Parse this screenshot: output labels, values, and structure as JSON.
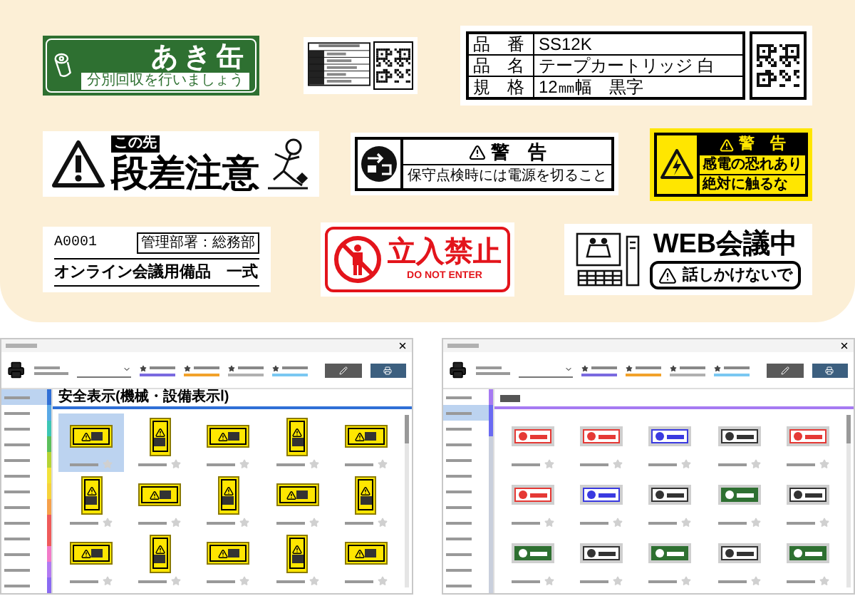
{
  "showcase": {
    "label_rows": [
      {
        "labels": [
          {
            "kind": "recycle",
            "title": "あき缶",
            "subtitle": "分別回収を行いましょう"
          },
          {
            "kind": "asset"
          },
          {
            "kind": "product",
            "rows": [
              {
                "key": "品　番",
                "value": "SS12K"
              },
              {
                "key": "品　名",
                "value": "テープカートリッジ 白"
              },
              {
                "key": "規　格",
                "value": "12㎜幅　黒字"
              }
            ]
          }
        ]
      },
      {
        "labels": [
          {
            "kind": "step-caution",
            "badge": "この先",
            "title": "段差注意"
          },
          {
            "kind": "power-warning",
            "title": "警　告",
            "text": "保守点検時には電源を切ること"
          },
          {
            "kind": "shock-warning",
            "title": "警　告",
            "lines": [
              "感電の恐れあり",
              "絶対に触るな"
            ]
          }
        ]
      },
      {
        "labels": [
          {
            "kind": "equipment",
            "code": "A0001",
            "department": "管理部署：総務部",
            "text": "オンライン会議用備品　一式"
          },
          {
            "kind": "no-entry",
            "title": "立入禁止",
            "subtitle": "DO NOT ENTER"
          },
          {
            "kind": "meeting",
            "title": "WEB会議中",
            "text": "話しかけないで"
          }
        ]
      }
    ]
  },
  "windows": [
    {
      "heading": "安全表示(機械・設備表示Ⅰ)",
      "sidebar": [
        {
          "color": "#2f6fd6",
          "selected": true
        },
        {
          "color": "#5aa9e6",
          "selected": false
        },
        {
          "color": "#3cc6b5",
          "selected": false
        },
        {
          "color": "#5bbf5b",
          "selected": false
        },
        {
          "color": "#b5d334",
          "selected": false
        },
        {
          "color": "#f2e23a",
          "selected": false
        },
        {
          "color": "#f7d23a",
          "selected": false
        },
        {
          "color": "#f6a04a",
          "selected": false
        },
        {
          "color": "#ef5a5a",
          "selected": false
        },
        {
          "color": "#ef5a5a",
          "selected": false
        },
        {
          "color": "#f27ac8",
          "selected": false
        },
        {
          "color": "#b27af2",
          "selected": false
        },
        {
          "color": "#8a6af2",
          "selected": false
        }
      ],
      "items": [
        {
          "kind": "landscape-sign",
          "selected": true
        },
        {
          "kind": "portrait-sign",
          "selected": false
        },
        {
          "kind": "landscape-sign",
          "selected": false
        },
        {
          "kind": "portrait-sign",
          "selected": false
        },
        {
          "kind": "landscape-sign",
          "selected": false
        },
        {
          "kind": "portrait-sign",
          "selected": false
        },
        {
          "kind": "landscape-sign",
          "selected": false
        },
        {
          "kind": "portrait-sign",
          "selected": false
        },
        {
          "kind": "landscape-sign",
          "selected": false
        },
        {
          "kind": "portrait-sign",
          "selected": false
        },
        {
          "kind": "landscape-sign",
          "selected": false
        },
        {
          "kind": "portrait-sign",
          "selected": false
        },
        {
          "kind": "landscape-sign",
          "selected": false
        },
        {
          "kind": "portrait-sign",
          "selected": false
        },
        {
          "kind": "landscape-sign",
          "selected": false
        }
      ]
    },
    {
      "sidebar": [
        {
          "color": "#a67af2",
          "selected": false
        },
        {
          "color": "#6a6af2",
          "selected": true
        },
        {
          "color": "#6a6af2",
          "selected": false
        },
        {
          "color": "#c9cfdc",
          "selected": false
        },
        {
          "color": "#c9cfdc",
          "selected": false
        },
        {
          "color": "#c9cfdc",
          "selected": false
        },
        {
          "color": "#c9cfdc",
          "selected": false
        },
        {
          "color": "#c9cfdc",
          "selected": false
        },
        {
          "color": "#c9cfdc",
          "selected": false
        },
        {
          "color": "#c9cfdc",
          "selected": false
        },
        {
          "color": "#c9cfdc",
          "selected": false
        },
        {
          "color": "#c9cfdc",
          "selected": false
        },
        {
          "color": "#c9cfdc",
          "selected": false
        }
      ],
      "items": [
        {
          "kind": "tape-label",
          "color": "#e53935",
          "filled": false,
          "selected": false
        },
        {
          "kind": "tape-label",
          "color": "#e53935",
          "filled": false,
          "selected": false
        },
        {
          "kind": "tape-label",
          "color": "#3a3ae0",
          "filled": false,
          "selected": false
        },
        {
          "kind": "tape-label",
          "color": "#333333",
          "filled": false,
          "selected": false
        },
        {
          "kind": "tape-label",
          "color": "#e53935",
          "filled": false,
          "selected": false
        },
        {
          "kind": "tape-label",
          "color": "#e53935",
          "filled": false,
          "selected": false
        },
        {
          "kind": "tape-label",
          "color": "#3a3ae0",
          "filled": false,
          "selected": false
        },
        {
          "kind": "tape-label",
          "color": "#333333",
          "filled": false,
          "selected": false
        },
        {
          "kind": "tape-label",
          "color": "#2e7031",
          "filled": true,
          "selected": false
        },
        {
          "kind": "tape-label",
          "color": "#333333",
          "filled": false,
          "selected": false
        },
        {
          "kind": "tape-label",
          "color": "#2e7031",
          "filled": true,
          "selected": false
        },
        {
          "kind": "tape-label",
          "color": "#333333",
          "filled": false,
          "selected": false
        },
        {
          "kind": "tape-label",
          "color": "#2e7031",
          "filled": true,
          "selected": false
        },
        {
          "kind": "tape-label",
          "color": "#333333",
          "filled": false,
          "selected": false
        },
        {
          "kind": "tape-label",
          "color": "#2e7031",
          "filled": true,
          "selected": false
        }
      ]
    }
  ]
}
